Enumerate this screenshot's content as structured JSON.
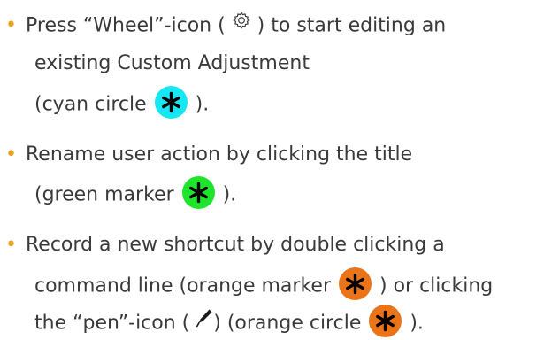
{
  "colors": {
    "bullet": "#e8a21a",
    "text": "#3a3a3a",
    "cyan": "#17e7f2",
    "green": "#1ee52c",
    "orange": "#eb7418",
    "asterisk": "#000000"
  },
  "icons": {
    "wheel": "gear-icon",
    "pen": "pen-icon",
    "marker": "asterisk-icon"
  },
  "bullet_char": "•",
  "items": [
    {
      "lines": [
        {
          "a": "Press “Wheel”-icon ( ",
          "b": " ) to start editing an"
        },
        {
          "a": "existing Custom Adjustment"
        },
        {
          "a": "(cyan circle ",
          "b": " )."
        }
      ]
    },
    {
      "lines": [
        {
          "a": "Rename user action by clicking the title"
        },
        {
          "a": "(green marker ",
          "b": " )."
        }
      ]
    },
    {
      "lines": [
        {
          "a": "Record a new shortcut by double clicking a"
        },
        {
          "a": "command line (orange marker ",
          "b": " ) or clicking"
        },
        {
          "a": "the “pen”-icon ( ",
          "b": ") (orange circle ",
          "c": " )."
        }
      ]
    }
  ]
}
